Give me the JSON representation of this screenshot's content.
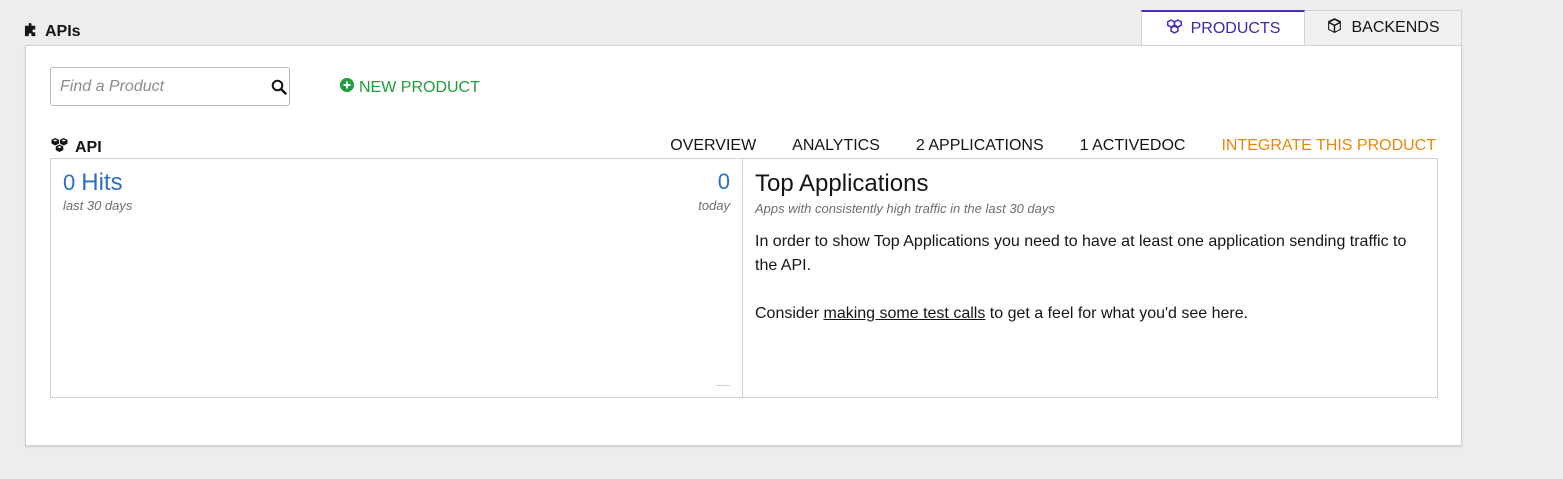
{
  "header": {
    "title": "APIs",
    "tabs": [
      {
        "label": "PRODUCTS",
        "icon": "cubes-icon",
        "active": true
      },
      {
        "label": "BACKENDS",
        "icon": "cube-icon",
        "active": false
      }
    ]
  },
  "toolbar": {
    "search_placeholder": "Find a Product",
    "new_product_label": "NEW PRODUCT"
  },
  "product": {
    "name": "API",
    "nav": {
      "overview": "OVERVIEW",
      "analytics": "ANALYTICS",
      "applications": "2 APPLICATIONS",
      "activedocs": "1 ACTIVEDOC",
      "integrate": "INTEGRATE THIS PRODUCT"
    },
    "hits": {
      "count": "0",
      "label": "Hits",
      "period": "last 30 days",
      "today_count": "0",
      "today_label": "today"
    },
    "top_applications": {
      "title": "Top Applications",
      "subtitle": "Apps with consistently high traffic in the last 30 days",
      "body": "In order to show Top Applications you need to have at least one application sending traffic to the API.",
      "consider_prefix": "Consider ",
      "link_text": "making some test calls",
      "consider_suffix": " to get a feel for what you'd see here."
    }
  },
  "colors": {
    "accent_purple": "#3d28a8",
    "link_blue": "#2c6fc1",
    "success_green": "#1e9e3c",
    "warning_orange": "#e5870e"
  }
}
